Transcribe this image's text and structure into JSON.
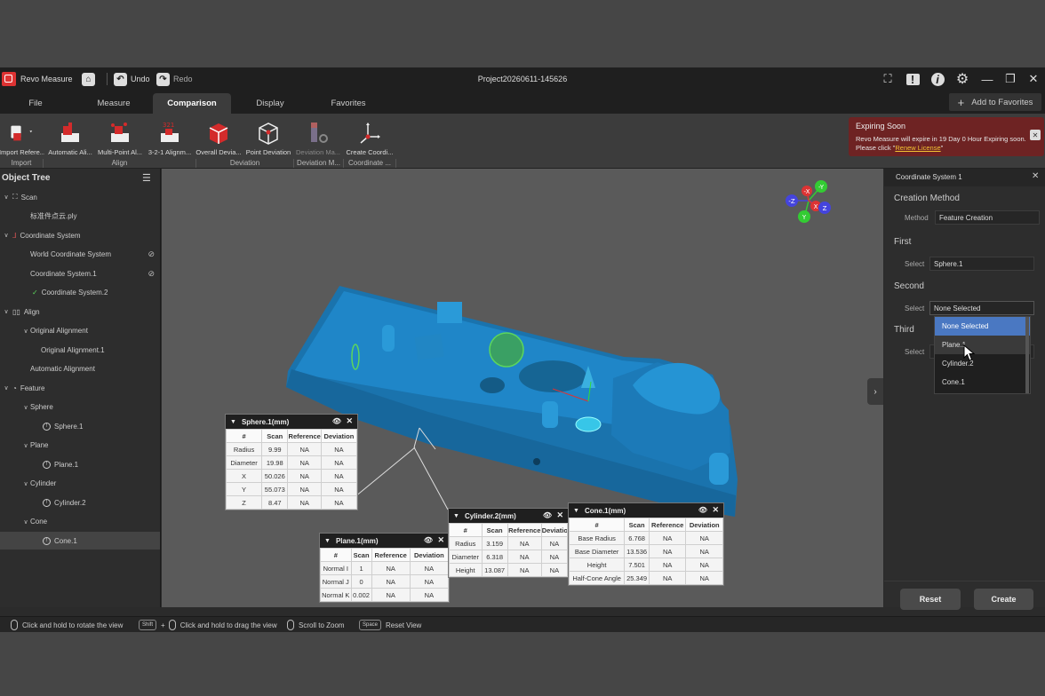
{
  "app": {
    "name": "Revo Measure",
    "project_title": "Project20260611-145626",
    "undo_label": "Undo",
    "redo_label": "Redo",
    "add_favorites_label": "Add to Favorites"
  },
  "menu_tabs": [
    "File",
    "Measure",
    "Comparison",
    "Display",
    "Favorites"
  ],
  "ribbon": {
    "buttons": [
      {
        "label": "Import Refere...",
        "icon": "import-reference-icon"
      },
      {
        "label": "Automatic Ali...",
        "icon": "automatic-alignment-icon"
      },
      {
        "label": "Multi-Point Al...",
        "icon": "multi-point-alignment-icon"
      },
      {
        "label": "3-2-1 Alignm...",
        "icon": "alignment-321-icon"
      },
      {
        "label": "Overall Devia...",
        "icon": "overall-deviation-icon"
      },
      {
        "label": "Point Deviation",
        "icon": "point-deviation-icon"
      },
      {
        "label": "Deviation Ma...",
        "icon": "deviation-map-icon"
      },
      {
        "label": "Create Coordi...",
        "icon": "create-coordinate-icon"
      }
    ],
    "groups": [
      "Import",
      "Align",
      "Deviation",
      "Deviation M...",
      "Coordinate ..."
    ]
  },
  "expire_notice": {
    "title": "Expiring Soon",
    "text": "Revo Measure will expire in 19 Day 0 Hour Expiring soon. Please click \"",
    "link": "Renew License",
    "text_end": "\""
  },
  "object_tree": {
    "title": "Object Tree",
    "items": [
      {
        "label": "Scan",
        "icon": "scan-icon",
        "level": 0
      },
      {
        "label": "标准件点云.ply",
        "icon": "",
        "level": 1
      },
      {
        "label": "Coordinate System",
        "icon": "coordinate-system-icon",
        "level": 0
      },
      {
        "label": "World Coordinate System",
        "icon": "",
        "level": 1
      },
      {
        "label": "Coordinate System.1",
        "icon": "",
        "level": 1
      },
      {
        "label": "Coordinate System.2",
        "icon": "check-icon",
        "level": 1
      },
      {
        "label": "Align",
        "icon": "align-icon",
        "level": 0
      },
      {
        "label": "Original Alignment",
        "icon": "",
        "level": 1
      },
      {
        "label": "Original Alignment.1",
        "icon": "",
        "level": 2
      },
      {
        "label": "Automatic Alignment",
        "icon": "",
        "level": 1
      },
      {
        "label": "Feature",
        "icon": "feature-icon",
        "level": 0
      },
      {
        "label": "Sphere",
        "icon": "",
        "level": 1
      },
      {
        "label": "Sphere.1",
        "icon": "info-icon",
        "level": 2
      },
      {
        "label": "Plane",
        "icon": "",
        "level": 1
      },
      {
        "label": "Plane.1",
        "icon": "info-icon",
        "level": 2
      },
      {
        "label": "Cylinder",
        "icon": "",
        "level": 1
      },
      {
        "label": "Cylinder.2",
        "icon": "info-icon",
        "level": 2
      },
      {
        "label": "Cone",
        "icon": "",
        "level": 1
      },
      {
        "label": "Cone.1",
        "icon": "info-icon",
        "level": 2
      }
    ]
  },
  "right_panel": {
    "title": "Coordinate System 1",
    "creation_method_heading": "Creation Method",
    "method_label": "Method",
    "method_value": "Feature Creation",
    "first_heading": "First",
    "first_select_label": "Select",
    "first_value": "Sphere.1",
    "second_heading": "Second",
    "second_select_label": "Select",
    "second_value": "None Selected",
    "third_heading": "Third",
    "third_select_label": "Select",
    "dropdown_options": [
      "None Selected",
      "Plane.1",
      "Cylinder.2",
      "Cone.1"
    ],
    "reset_label": "Reset",
    "create_label": "Create"
  },
  "axes": {
    "x": "X",
    "y": "Y",
    "z": "Z",
    "neg_x": "-X",
    "neg_y": "-Y",
    "neg_z": "-Z"
  },
  "tables": {
    "sphere": {
      "title": "Sphere.1(mm)",
      "headers": [
        "#",
        "Scan",
        "Reference",
        "Deviation"
      ],
      "rows": [
        [
          "Radius",
          "9.99",
          "NA",
          "NA"
        ],
        [
          "Diameter",
          "19.98",
          "NA",
          "NA"
        ],
        [
          "X",
          "50.026",
          "NA",
          "NA"
        ],
        [
          "Y",
          "55.073",
          "NA",
          "NA"
        ],
        [
          "Z",
          "8.47",
          "NA",
          "NA"
        ]
      ]
    },
    "plane": {
      "title": "Plane.1(mm)",
      "headers": [
        "#",
        "Scan",
        "Reference",
        "Deviation"
      ],
      "rows": [
        [
          "Normal I",
          "1",
          "NA",
          "NA"
        ],
        [
          "Normal J",
          "0",
          "NA",
          "NA"
        ],
        [
          "Normal K",
          "0.002",
          "NA",
          "NA"
        ]
      ]
    },
    "cylinder": {
      "title": "Cylinder.2(mm)",
      "headers": [
        "#",
        "Scan",
        "Reference",
        "Deviation"
      ],
      "rows": [
        [
          "Radius",
          "3.159",
          "NA",
          "NA"
        ],
        [
          "Diameter",
          "6.318",
          "NA",
          "NA"
        ],
        [
          "Height",
          "13.087",
          "NA",
          "NA"
        ]
      ]
    },
    "cone": {
      "title": "Cone.1(mm)",
      "headers": [
        "#",
        "Scan",
        "Reference",
        "Deviation"
      ],
      "rows": [
        [
          "Base Radius",
          "6.768",
          "NA",
          "NA"
        ],
        [
          "Base Diameter",
          "13.536",
          "NA",
          "NA"
        ],
        [
          "Height",
          "7.501",
          "NA",
          "NA"
        ],
        [
          "Half-Cone Angle",
          "25.349",
          "NA",
          "NA"
        ]
      ]
    }
  },
  "status_bar": {
    "rotate": "Click and hold to rotate the view",
    "shift_key": "Shift",
    "drag": "Click and hold to drag the view",
    "zoom": "Scroll to Zoom",
    "space_key": "Space",
    "reset_view": "Reset View"
  },
  "colors": {
    "accent": "#4a78c2",
    "model": "#1f86c8",
    "feature": "#5cd65c",
    "expire_bg": "#6e2323"
  }
}
